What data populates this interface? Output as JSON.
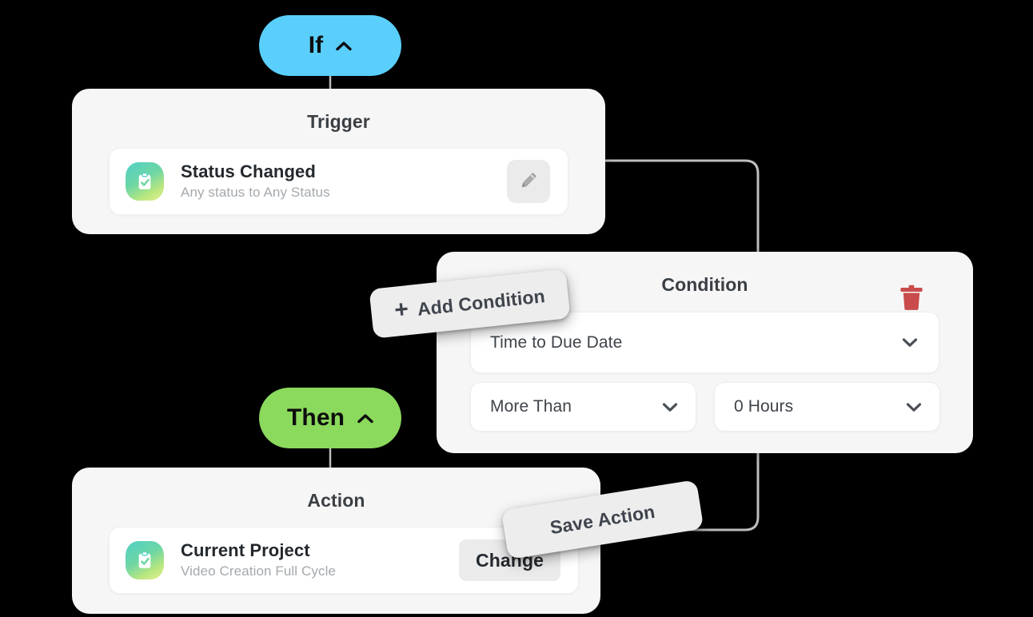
{
  "canvas": {
    "background_color": "#000000"
  },
  "branches": [
    {
      "key": "if",
      "label": "If",
      "color": "#5ACFFB",
      "chevron_icon": "chevron-up-icon",
      "expanded": true
    },
    {
      "key": "then",
      "label": "Then",
      "color": "#8BD95D",
      "chevron_icon": "chevron-up-icon",
      "expanded": true
    }
  ],
  "trigger_card": {
    "title": "Trigger",
    "item": {
      "icon": "clipboard-check-icon",
      "title": "Status Changed",
      "subtitle": "Any status to Any Status"
    },
    "edit_button": {
      "icon": "pencil-icon",
      "aria_label": "Edit trigger"
    }
  },
  "condition_card": {
    "title": "Condition",
    "delete_button": {
      "icon": "trash-icon",
      "aria_label": "Delete condition",
      "color": "#C94B4B"
    },
    "fields": [
      {
        "name": "field-select",
        "value": "Time to Due Date",
        "chevron_icon": "chevron-down-icon",
        "options": [
          "Time to Due Date"
        ]
      },
      {
        "name": "operator-select",
        "value": "More Than",
        "chevron_icon": "chevron-down-icon",
        "options": [
          "More Than"
        ]
      },
      {
        "name": "value-select",
        "value": "0 Hours",
        "chevron_icon": "chevron-down-icon",
        "options": [
          "0 Hours"
        ]
      }
    ]
  },
  "action_card": {
    "title": "Action",
    "item": {
      "icon": "clipboard-check-icon",
      "title": "Current Project",
      "subtitle": "Video Creation Full Cycle"
    },
    "change_button": {
      "label": "Change"
    }
  },
  "floating_buttons": [
    {
      "key": "add_condition",
      "label": "Add Condition",
      "plus_glyph": "+",
      "icon": "plus-icon",
      "rotation_deg": -6
    },
    {
      "key": "save_action",
      "label": "Save Action",
      "rotation_deg": -9
    }
  ]
}
